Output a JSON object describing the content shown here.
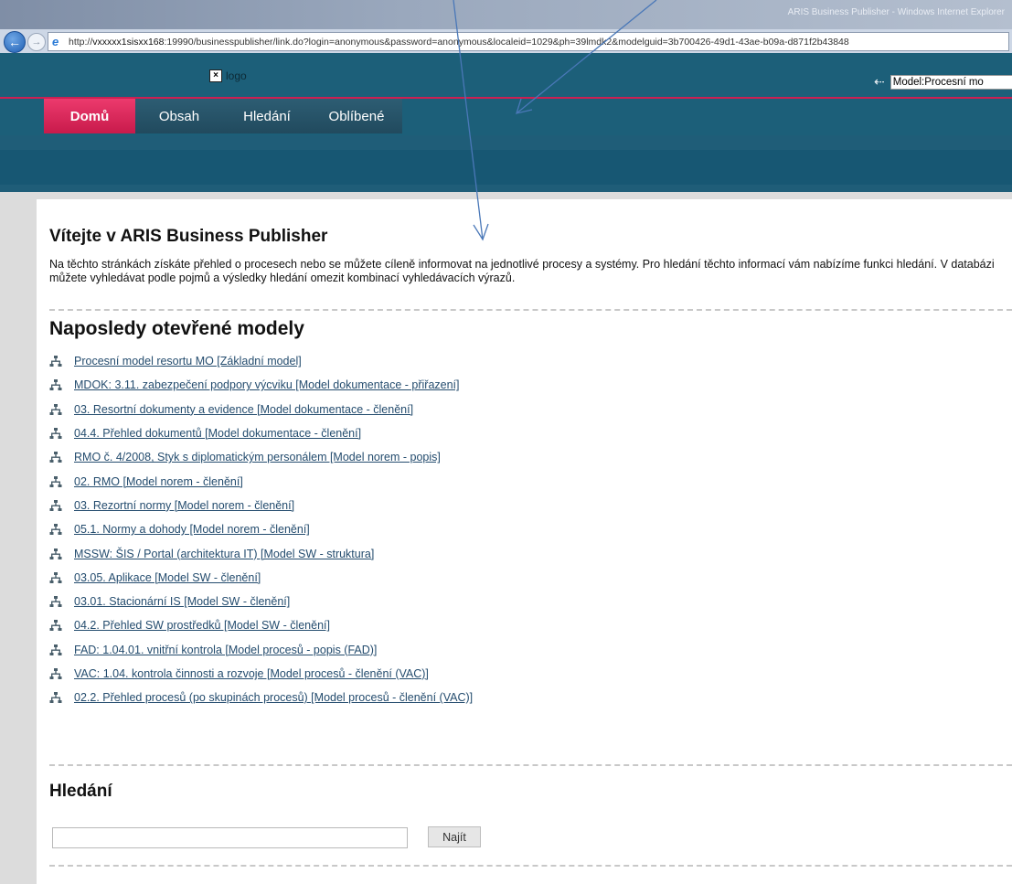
{
  "browser": {
    "url_prefix": "http://",
    "url_host": "vxxxxx1sisxx168",
    "url_rest": ":19990/businesspublisher/link.do?login=anonymous&password=anonymous&localeid=1029&ph=39lmdk2&modelguid=3b700426-49d1-43ae-b09a-d871f2b43848",
    "title": "ARIS Business Publisher - Windows Internet Explorer"
  },
  "header": {
    "logo_text": "logo",
    "model_field_value": "Model:Procesní mo"
  },
  "tabs": [
    {
      "label": "Domů",
      "active": true
    },
    {
      "label": "Obsah",
      "active": false
    },
    {
      "label": "Hledání",
      "active": false
    },
    {
      "label": "Oblíbené",
      "active": false
    }
  ],
  "welcome": {
    "title": "Vítejte v ARIS Business Publisher",
    "text": "Na těchto stránkách získáte přehled o procesech nebo se můžete cíleně informovat na jednotlivé procesy a systémy. Pro hledání těchto informací vám nabízíme funkci hledání. V databázi můžete vyhledávat podle pojmů a výsledky hledání omezit kombinací vyhledávacích výrazů."
  },
  "recent": {
    "title": "Naposledy otevřené modely",
    "items": [
      "Procesní model resortu MO [Základní model]",
      "MDOK: 3.11. zabezpečení podpory výcviku [Model dokumentace - přiřazení]",
      "03. Resortní dokumenty a evidence [Model dokumentace - členění]",
      "04.4. Přehled dokumentů [Model dokumentace - členění]",
      "RMO č. 4/2008, Styk s diplomatickým personálem [Model norem - popis]",
      "02. RMO [Model norem - členění]",
      "03. Rezortní normy [Model norem - členění]",
      "05.1. Normy a dohody [Model norem - členění]",
      "MSSW: ŠIS / Portal (architektura IT) [Model SW - struktura]",
      "03.05. Aplikace [Model SW - členění]",
      "03.01. Stacionární IS [Model SW - členění]",
      "04.2. Přehled SW prostředků [Model SW - členění]",
      "FAD: 1.04.01. vnitřní kontrola [Model procesů - popis (FAD)]",
      "VAC: 1.04. kontrola činnosti a rozvoje [Model procesů - členění (VAC)]",
      "02.2. Přehled procesů (po skupinách procesů) [Model procesů - členění (VAC)]"
    ]
  },
  "search": {
    "title": "Hledání",
    "input_value": "",
    "button_label": "Najít"
  },
  "colors": {
    "header_bg": "#1c5f79",
    "accent_pink": "#cc1f52",
    "link": "#244c6e",
    "annotation_arrow": "#4a78b8"
  }
}
